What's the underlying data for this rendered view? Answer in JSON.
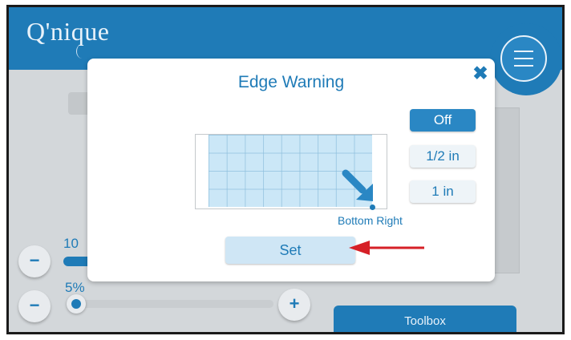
{
  "app": {
    "logo_text": "Q'nique"
  },
  "background": {
    "value_label": "10",
    "percent_label": "5%",
    "minus_label": "−",
    "plus_label": "+",
    "toolbox_label": "Toolbox"
  },
  "dialog": {
    "title": "Edge Warning",
    "close_label": "✖",
    "options": [
      {
        "label": "Off",
        "selected": true
      },
      {
        "label": "1/2 in",
        "selected": false
      },
      {
        "label": "1 in",
        "selected": false
      }
    ],
    "position_label": "Bottom Right",
    "set_label": "Set"
  },
  "colors": {
    "brand_blue": "#1f7bb7",
    "annotation_red": "#d62027"
  },
  "icons": [
    "menu-icon",
    "close-icon",
    "diagonal-arrow-icon",
    "annotation-arrow-icon"
  ]
}
